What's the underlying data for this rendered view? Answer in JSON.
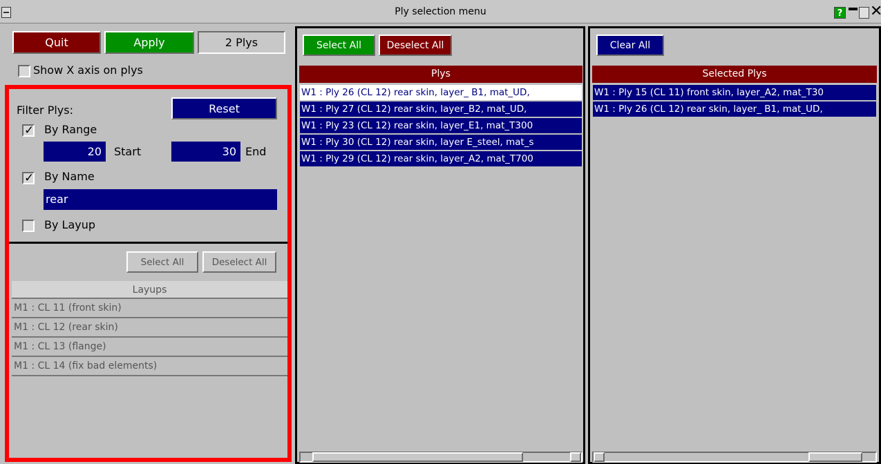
{
  "window": {
    "title": "Ply selection menu"
  },
  "top_buttons": {
    "quit": "Quit",
    "apply": "Apply",
    "ply_count": "2 Plys"
  },
  "options": {
    "show_x_axis": "Show X axis on plys"
  },
  "filter": {
    "label": "Filter Plys:",
    "reset": "Reset",
    "by_range": "By Range",
    "range_start_value": "20",
    "start_label": "Start",
    "range_end_value": "30",
    "end_label": "End",
    "by_name": "By Name",
    "name_value": "rear",
    "by_layup": "By Layup"
  },
  "layups": {
    "select_all": "Select All",
    "deselect_all": "Deselect All",
    "header": "Layups",
    "items": [
      "M1 : CL 11 (front skin)",
      "M1 : CL 12 (rear skin)",
      "M1 : CL 13 (flange)",
      "M1 : CL 14 (fix bad elements)"
    ]
  },
  "plys_panel": {
    "select_all": "Select All",
    "deselect_all": "Deselect All",
    "header": "Plys",
    "items": [
      "W1 : Ply 26 (CL 12) rear skin, layer_ B1, mat_UD,",
      "W1 : Ply 27 (CL 12) rear skin, layer_B2, mat_UD,",
      "W1 : Ply 23 (CL 12) rear skin, layer_E1, mat_T300",
      "W1 : Ply 30 (CL 12) rear skin, layer E_steel, mat_s",
      "W1 : Ply 29 (CL 12) rear skin, layer_A2, mat_T700"
    ]
  },
  "selected_panel": {
    "clear_all": "Clear All",
    "header": "Selected Plys",
    "items": [
      "W1 : Ply 15 (CL 11) front skin, layer_A2, mat_T30",
      "W1 : Ply 26 (CL 12) rear skin, layer_ B1, mat_UD,"
    ]
  },
  "colors": {
    "navy": "#000080",
    "dark_red": "#800000",
    "green": "#009000",
    "highlight": "#ff0000"
  }
}
